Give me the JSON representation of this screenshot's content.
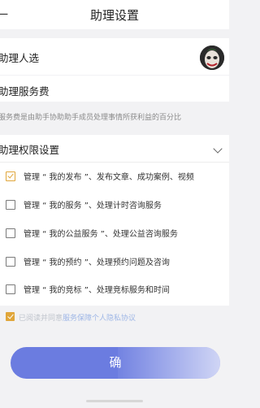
{
  "header": {
    "back_label": "一",
    "title": "助理设置"
  },
  "rows": {
    "candidate_label": "助理人选",
    "fee_label": "助理服务费",
    "fee_note": "服务费是由助手协助助手成员处理事情所获利益的百分比",
    "permissions_label": "助理权限设置"
  },
  "permissions": [
    {
      "label": "管理 “ 我的发布 ”、发布文章、成功案例、视频",
      "checked": true
    },
    {
      "label": "管理 “ 我的服务 ”、处理计时咨询服务",
      "checked": false
    },
    {
      "label": "管理 “ 我的公益服务 ”、处理公益咨询服务",
      "checked": false
    },
    {
      "label": "管理 “ 我的预约 ”、处理预约问题及咨询",
      "checked": false
    },
    {
      "label": "管理 “ 我的竞标 ”、处理竞标服务和时间",
      "checked": false
    }
  ],
  "agreement": {
    "prefix": "已阅读并同意",
    "link": "服务保障个人隐私协议",
    "checked": true
  },
  "confirm_label": "确",
  "colors": {
    "accent": "#6b7ce0",
    "checkbox": "#e0a63a"
  },
  "icons": {
    "avatar": "avatar-image",
    "expand": "chevron-down-icon",
    "check": "check-icon"
  }
}
